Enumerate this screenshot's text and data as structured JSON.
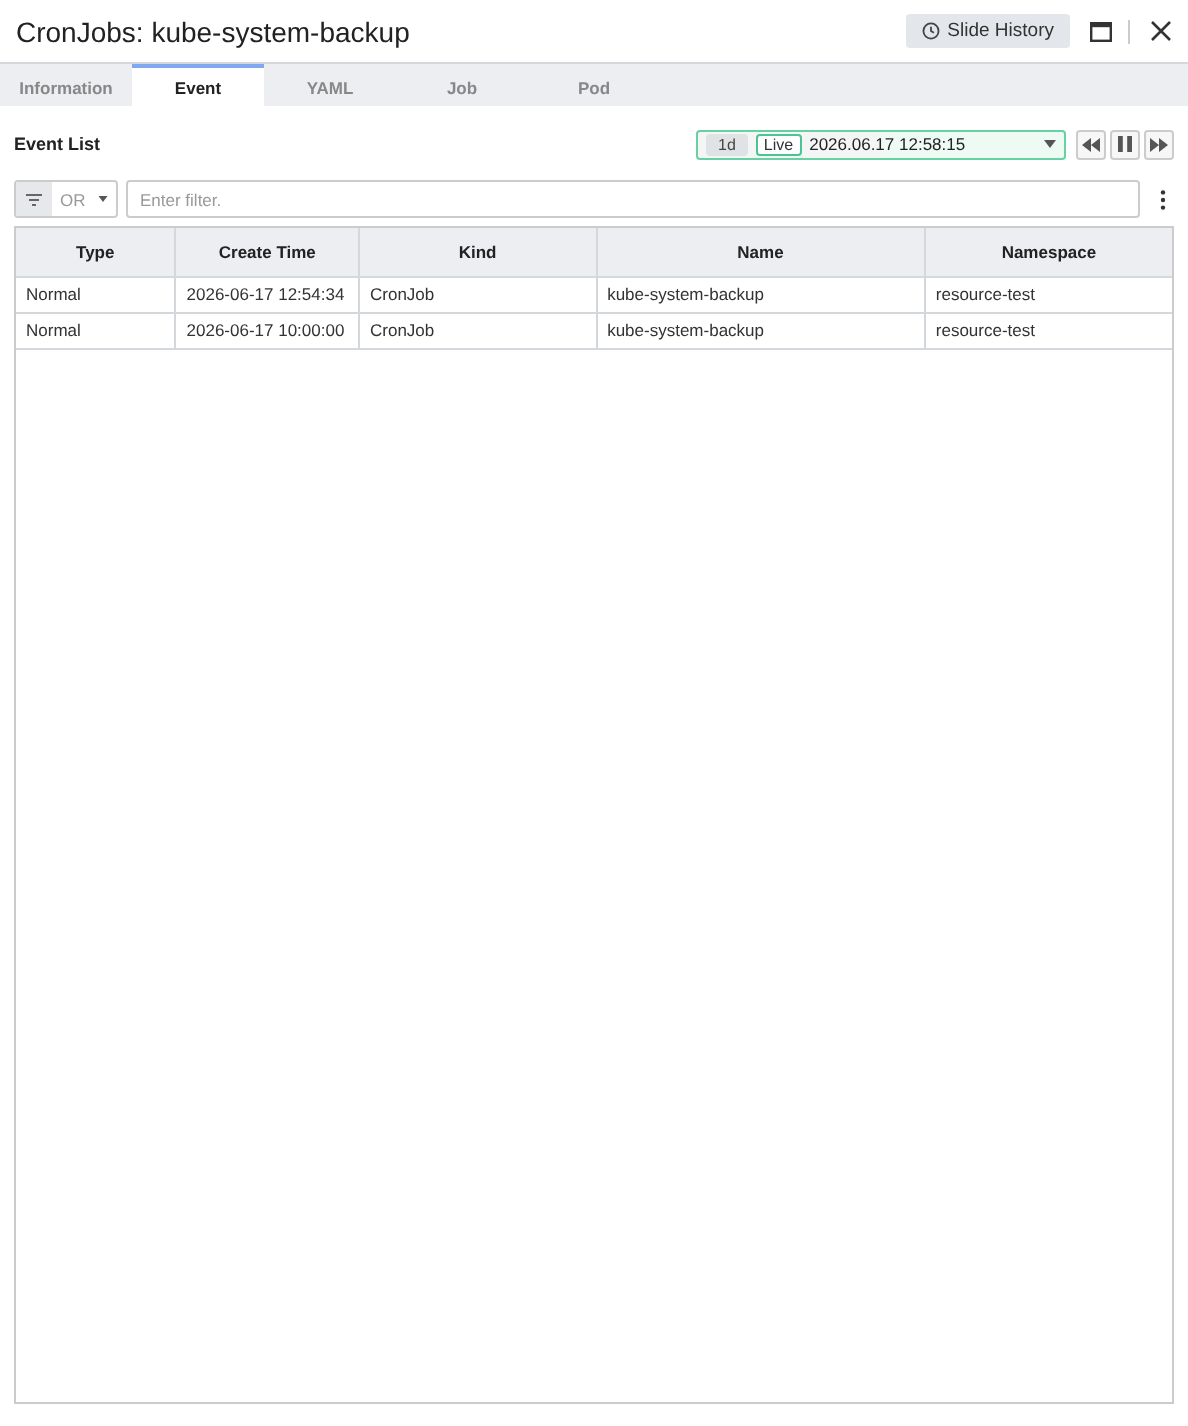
{
  "window": {
    "title": "CronJobs: kube-system-backup",
    "history_button": "Slide History"
  },
  "tabs": [
    {
      "label": "Information",
      "selected": false
    },
    {
      "label": "Event",
      "selected": true
    },
    {
      "label": "YAML",
      "selected": false
    },
    {
      "label": "Job",
      "selected": false
    },
    {
      "label": "Pod",
      "selected": false
    }
  ],
  "section_title": "Event List",
  "time_control": {
    "range": "1d",
    "live": "Live",
    "live_on": true,
    "timestamp": "2026.06.17 12:58:15"
  },
  "filter": {
    "operator": "OR",
    "placeholder": "Enter filter."
  },
  "table": {
    "columns": [
      "Type",
      "Create Time",
      "Kind",
      "Name",
      "Namespace"
    ],
    "rows": [
      [
        "Normal",
        "2026-06-17 12:54:34",
        "CronJob",
        "kube-system-backup",
        "resource-test"
      ],
      [
        "Normal",
        "2026-06-17 10:00:00",
        "CronJob",
        "kube-system-backup",
        "resource-test"
      ]
    ]
  }
}
